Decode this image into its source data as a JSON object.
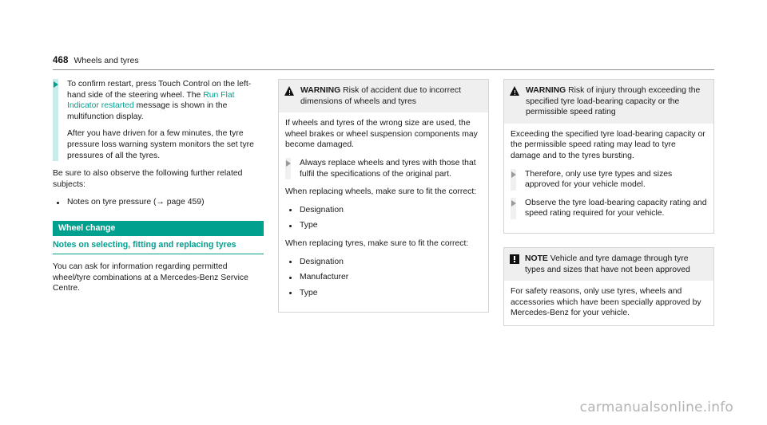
{
  "header": {
    "page_number": "468",
    "chapter": "Wheels and tyres"
  },
  "left_column": {
    "action_block": {
      "arrow_icon": "triangle-right-icon",
      "paragraphs": [
        {
          "before": "To confirm restart, press Touch Control on the left-hand side of the steering wheel. The ",
          "highlight": "Run Flat Indicator restarted",
          "after": " message is shown in the multifunction display."
        },
        {
          "text": "After you have driven for a few minutes, the tyre pressure loss warning system monitors the set tyre pressures of all the tyres."
        }
      ]
    },
    "intro": "Be sure to also observe the following further related subjects:",
    "bullets": [
      "Notes on tyre pressure (→ page 459)"
    ],
    "section_band": "Wheel change",
    "section_sub": "Notes on selecting, fitting and replacing tyres",
    "section_body": "You can ask for information regarding permitted wheel/tyre combinations at a Mercedes-Benz Service Centre."
  },
  "middle_column": {
    "callout": {
      "icon": "warning-triangle-icon",
      "kind": "WARNING",
      "head_text": " Risk of accident due to incorrect dimensions of wheels and tyres",
      "body_para_1": "If wheels and tyres of the wrong size are used, the wheel brakes or wheel suspension components may become damaged.",
      "action": {
        "arrow_icon": "triangle-right-icon",
        "text": "Always replace wheels and tyres with those that fulfil the specifications of the original part."
      },
      "body_para_2": "When replacing wheels, make sure to fit the correct:",
      "bullets_1": [
        "Designation",
        "Type"
      ],
      "body_para_3": "When replacing tyres, make sure to fit the correct:",
      "bullets_2": [
        "Designation",
        "Manufacturer",
        "Type"
      ]
    }
  },
  "right_column": {
    "warning_callout": {
      "icon": "warning-triangle-icon",
      "kind": "WARNING",
      "head_text": " Risk of injury through exceeding the specified tyre load-bearing capacity or the permissible speed rating",
      "body_para_1": "Exceeding the specified tyre load-bearing capacity or the permissible speed rating may lead to tyre damage and to the tyres bursting.",
      "actions": [
        "Therefore, only use tyre types and sizes approved for your vehicle model.",
        "Observe the tyre load-bearing capacity rating and speed rating required for your vehicle."
      ]
    },
    "note_callout": {
      "icon": "note-exclamation-icon",
      "kind": "NOTE",
      "head_text": " Vehicle and tyre damage through tyre types and sizes that have not been approved",
      "body_para_1": "For safety reasons, only use tyres, wheels and accessories which have been specially approved by Mercedes-Benz for your vehicle."
    }
  },
  "watermark": "carmanualsonline.info",
  "colors": {
    "teal": "#00a08f",
    "teal_light": "#c9ecea",
    "callout_head_bg": "#efefef",
    "callout_border": "#d5d5d5",
    "gray_bar": "#f0f0f0",
    "watermark": "#b4b4b4"
  }
}
